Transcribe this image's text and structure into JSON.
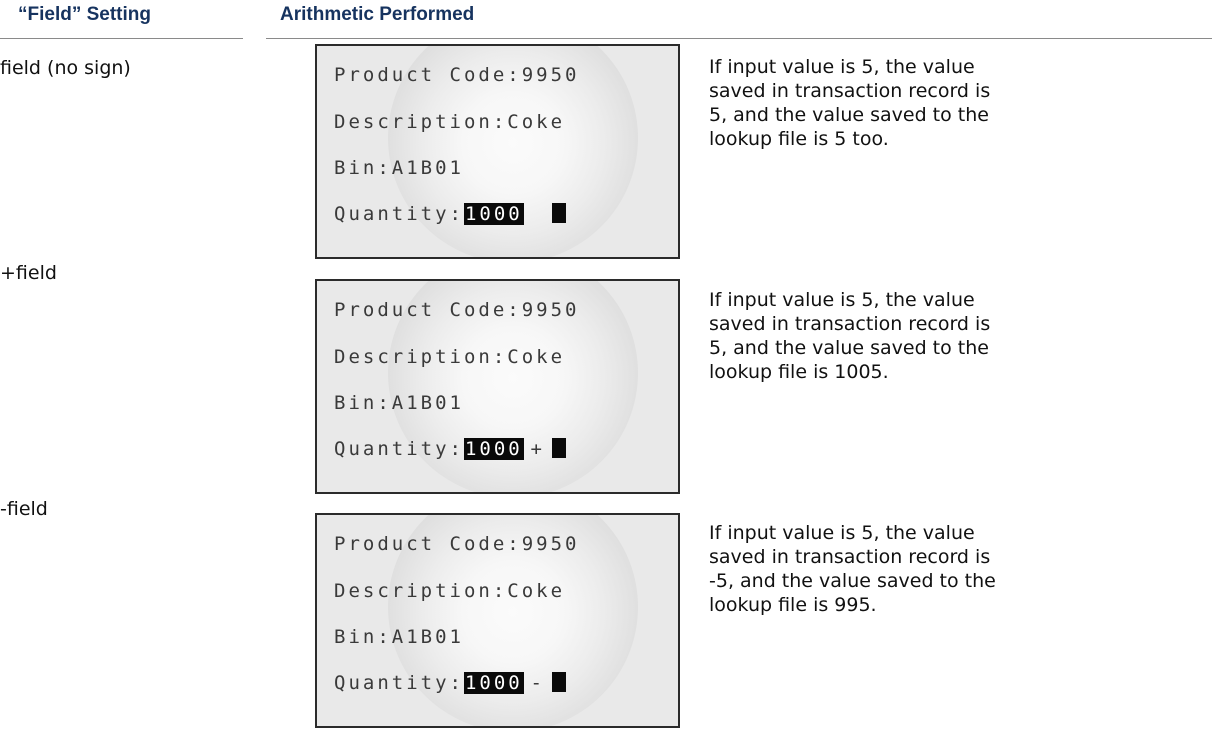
{
  "header": {
    "setting_title": "“Field” Setting",
    "arithmetic_title": "Arithmetic Performed"
  },
  "rows": [
    {
      "setting": "field (no sign)",
      "screen": {
        "line1": "Product Code:9950",
        "line2": "Description:Coke",
        "line3": "Bin:A1B01",
        "qty_label": "Quantity:",
        "qty_value": "1000",
        "sign": ""
      },
      "description": "If input value is 5, the value saved in transaction record is 5, and the value saved to the lookup file is 5 too."
    },
    {
      "setting": "+field",
      "screen": {
        "line1": "Product Code:9950",
        "line2": "Description:Coke",
        "line3": "Bin:A1B01",
        "qty_label": "Quantity:",
        "qty_value": "1000",
        "sign": "+"
      },
      "description": "If input value is 5, the value saved in transaction record is 5, and the value saved to the lookup file is 1005."
    },
    {
      "setting": "-field",
      "screen": {
        "line1": "Product Code:9950",
        "line2": "Description:Coke",
        "line3": "Bin:A1B01",
        "qty_label": "Quantity:",
        "qty_value": "1000",
        "sign": "-"
      },
      "description": "If input value is 5, the value saved in transaction record is -5, and the value saved to the lookup file is 995."
    }
  ]
}
